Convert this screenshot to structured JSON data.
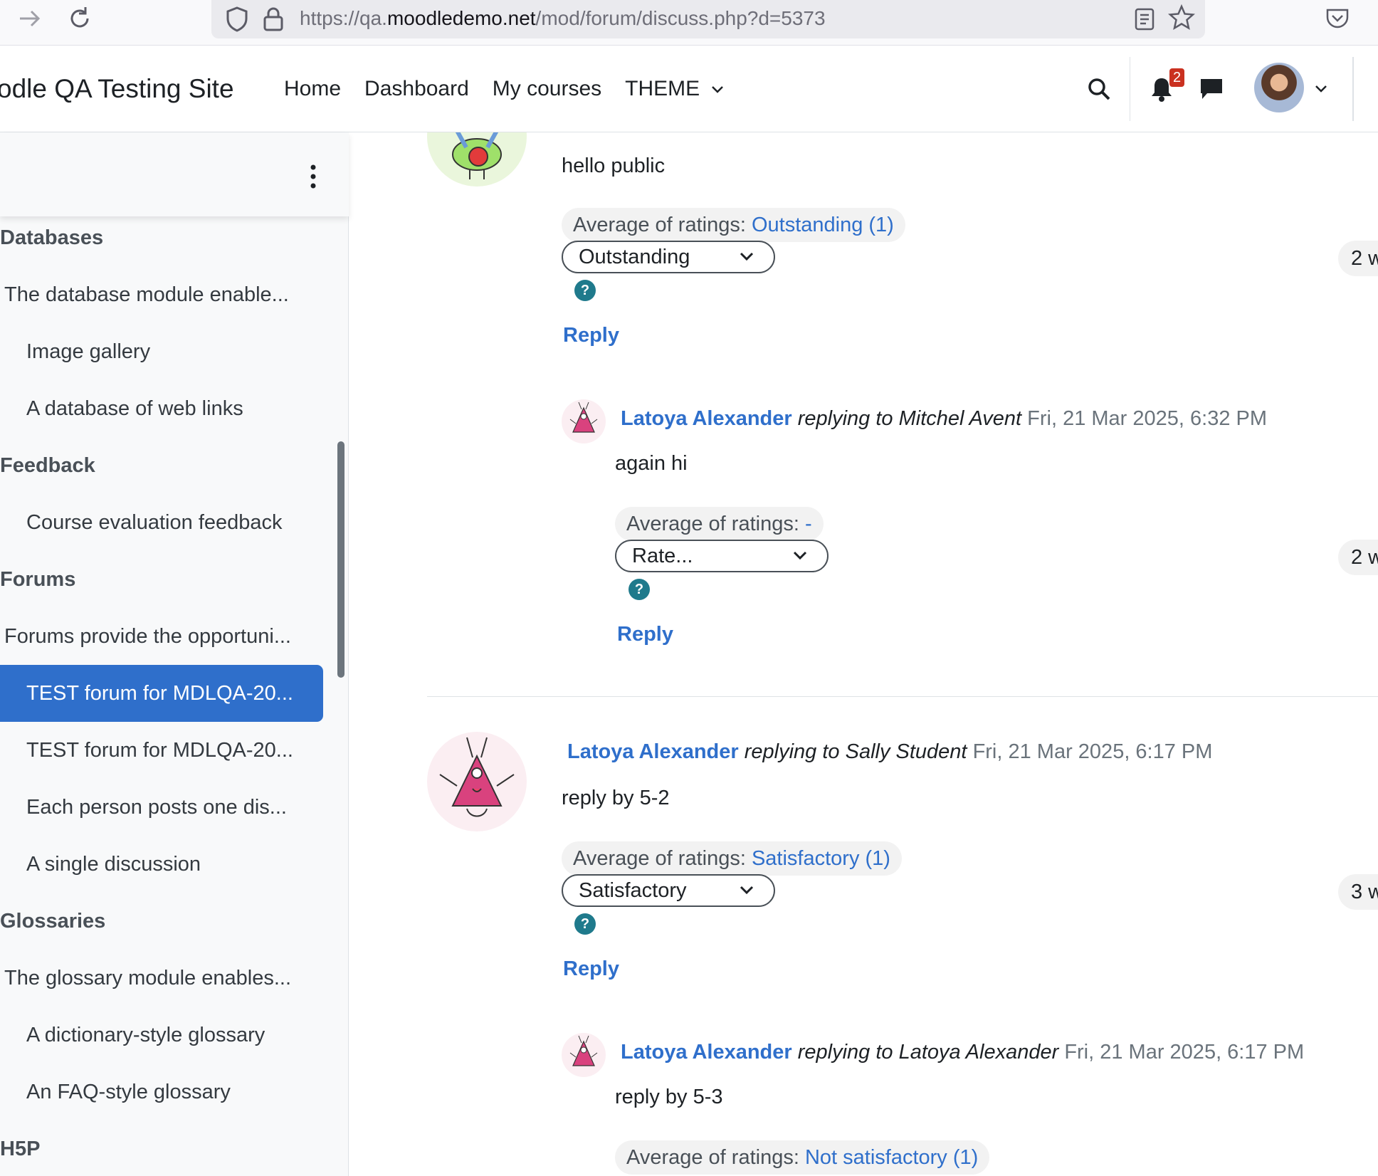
{
  "browser": {
    "url_prefix": "https://qa.",
    "url_domain": "moodledemo.net",
    "url_path": "/mod/forum/discuss.php?d=5373"
  },
  "navbar": {
    "site_name": "odle QA Testing Site",
    "links": [
      "Home",
      "Dashboard",
      "My courses",
      "THEME"
    ],
    "notification_count": "2"
  },
  "drawer": {
    "items": [
      {
        "label": "Databases",
        "kind": "section"
      },
      {
        "label": "The database module enable...",
        "kind": "indent1"
      },
      {
        "label": "Image gallery",
        "kind": "indent2"
      },
      {
        "label": "A database of web links",
        "kind": "indent2"
      },
      {
        "label": "Feedback",
        "kind": "section"
      },
      {
        "label": "Course evaluation feedback",
        "kind": "indent2"
      },
      {
        "label": "Forums",
        "kind": "section"
      },
      {
        "label": "Forums provide the opportuni...",
        "kind": "indent1"
      },
      {
        "label": "TEST forum for MDLQA-20...",
        "kind": "indent2 active"
      },
      {
        "label": "TEST forum for MDLQA-20...",
        "kind": "indent2"
      },
      {
        "label": "Each person posts one dis...",
        "kind": "indent2"
      },
      {
        "label": "A single discussion",
        "kind": "indent2"
      },
      {
        "label": "Glossaries",
        "kind": "section"
      },
      {
        "label": "The glossary module enables...",
        "kind": "indent1"
      },
      {
        "label": "A dictionary-style glossary",
        "kind": "indent2"
      },
      {
        "label": "An FAQ-style glossary",
        "kind": "indent2"
      },
      {
        "label": "H5P",
        "kind": "section"
      }
    ]
  },
  "posts": {
    "p1": {
      "body": "hello public",
      "avg_label": "Average of ratings:",
      "avg_value": "Outstanding (1)",
      "select_value": "Outstanding",
      "side": "2 w",
      "reply": "Reply"
    },
    "p2": {
      "author": "Latoya Alexander",
      "replying": "replying to Mitchel Avent",
      "date": "Fri, 21 Mar 2025, 6:32 PM",
      "body": "again hi",
      "avg_label": "Average of ratings:",
      "avg_value": "-",
      "select_value": "Rate...",
      "side": "2 w",
      "reply": "Reply"
    },
    "p3": {
      "author": "Latoya Alexander",
      "replying": "replying to Sally Student",
      "date": "Fri, 21 Mar 2025, 6:17 PM",
      "body": "reply by 5-2",
      "avg_label": "Average of ratings:",
      "avg_value": "Satisfactory (1)",
      "select_value": "Satisfactory",
      "side": "3 w",
      "reply": "Reply"
    },
    "p4": {
      "author": "Latoya Alexander",
      "replying": "replying to Latoya Alexander",
      "date": "Fri, 21 Mar 2025, 6:17 PM",
      "body": "reply by 5-3",
      "avg_label": "Average of ratings:",
      "avg_value": "Not satisfactory (1)"
    }
  },
  "help_glyph": "?",
  "colors": {
    "link": "#2f6fcb",
    "active": "#2f6fcb",
    "badge": "#ca3120",
    "help": "#1f7a8c"
  }
}
